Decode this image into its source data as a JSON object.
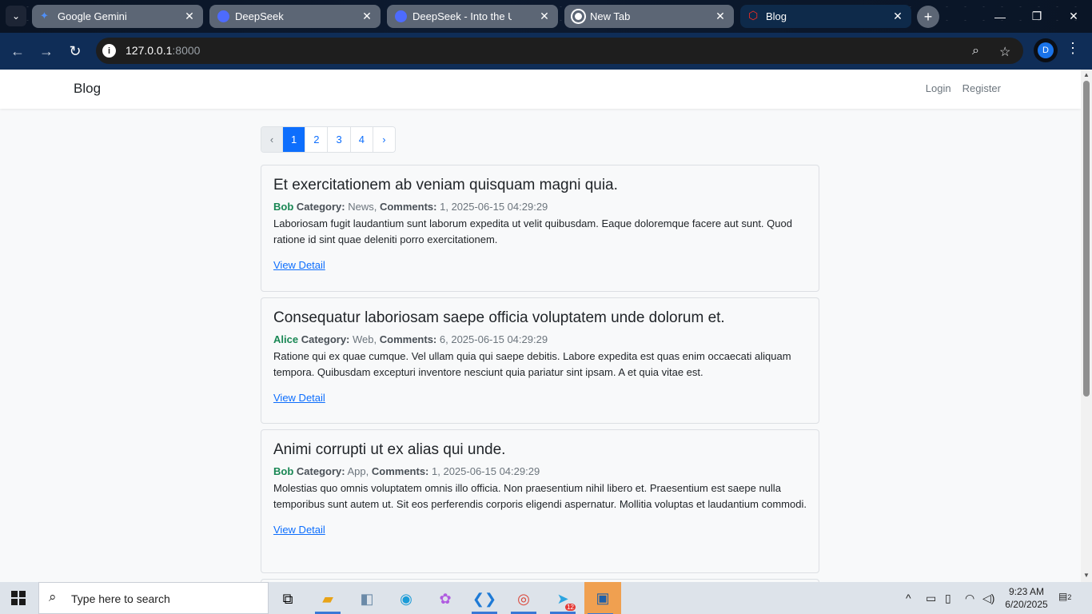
{
  "browser": {
    "tabs": [
      {
        "title": "Google Gemini",
        "favicon": "gemini-icon",
        "color": "#4f8ff7"
      },
      {
        "title": "DeepSeek",
        "favicon": "deepseek-icon",
        "color": "#4d6bfe"
      },
      {
        "title": "DeepSeek - Into the Unknown",
        "favicon": "deepseek-icon",
        "color": "#4d6bfe"
      },
      {
        "title": "New Tab",
        "favicon": "chrome-icon",
        "color": "#ffffff"
      },
      {
        "title": "Blog",
        "favicon": "laravel-icon",
        "color": "#ff2d20"
      }
    ],
    "url_host": "127.0.0.1",
    "url_port": ":8000",
    "profile_initial": "D"
  },
  "site": {
    "brand": "Blog",
    "nav": {
      "login": "Login",
      "register": "Register"
    },
    "pagination": {
      "prev": "‹",
      "pages": [
        "1",
        "2",
        "3",
        "4"
      ],
      "next": "›",
      "active": "1"
    },
    "posts": [
      {
        "title": "Et exercitationem ab veniam quisquam magni quia.",
        "author": "Bob",
        "category_label": "Category:",
        "category": "News,",
        "comments_label": "Comments:",
        "comments": "1, 2025-06-15 04:29:29",
        "body": "Laboriosam fugit laudantium sunt laborum expedita ut velit quibusdam. Eaque doloremque facere aut sunt. Quod ratione id sint quae deleniti porro exercitationem.",
        "link": "View Detail"
      },
      {
        "title": "Consequatur laboriosam saepe officia voluptatem unde dolorum et.",
        "author": "Alice",
        "category_label": "Category:",
        "category": "Web,",
        "comments_label": "Comments:",
        "comments": "6, 2025-06-15 04:29:29",
        "body": "Ratione qui ex quae cumque. Vel ullam quia qui saepe debitis. Labore expedita est quas enim occaecati aliquam tempora. Quibusdam excepturi inventore nesciunt quia pariatur sint ipsam. A et quia vitae est.",
        "link": "View Detail"
      },
      {
        "title": "Animi corrupti ut ex alias qui unde.",
        "author": "Bob",
        "category_label": "Category:",
        "category": "App,",
        "comments_label": "Comments:",
        "comments": "1, 2025-06-15 04:29:29",
        "body": "Molestias quo omnis voluptatem omnis illo officia. Non praesentium nihil libero et. Praesentium est saepe nulla temporibus sunt autem ut. Sit eos perferendis corporis eligendi aspernatur. Mollitia voluptas et laudantium commodi.",
        "link": "View Detail"
      }
    ]
  },
  "taskbar": {
    "search_placeholder": "Type here to search",
    "time": "9:23 AM",
    "date": "6/20/2025",
    "telegram_badge": "12",
    "notification_count": "2"
  },
  "colors": {
    "accent": "#0d6efd",
    "author": "#198754",
    "toolbar": "#0f2d57"
  }
}
